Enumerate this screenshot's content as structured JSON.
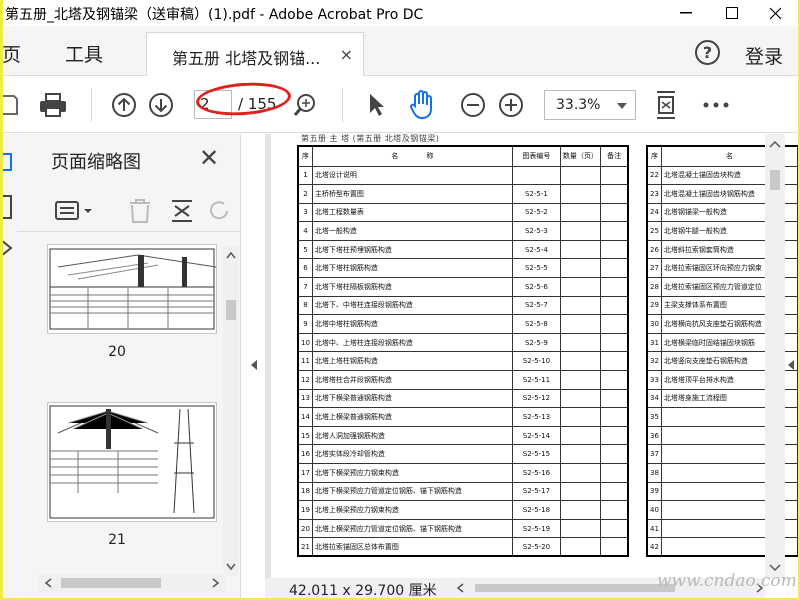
{
  "window": {
    "title": "第五册_北塔及钢锚梁（送审稿）(1).pdf - Adobe Acrobat Pro DC"
  },
  "tabs": {
    "home_label": "主页",
    "tools_label": "工具",
    "doc_tab_label": "第五册 北塔及钢锚...",
    "close_label": "×",
    "help_label": "?",
    "login_label": "登录"
  },
  "toolbar": {
    "current_page": "2",
    "page_total": "/ 155",
    "zoom": "33.3%"
  },
  "thumbnails": {
    "header": "页面缩略图",
    "items": [
      {
        "label": "20"
      },
      {
        "label": "21"
      }
    ]
  },
  "document": {
    "page_header": "第五册  主  塔 (第五册  北塔及钢锚梁)",
    "left_table": {
      "headers": [
        "序",
        "名　　　　称",
        "图表编号",
        "数量（页）",
        "备注"
      ],
      "rows": [
        [
          "1",
          "北塔设计说明",
          "",
          "",
          ""
        ],
        [
          "2",
          "主桥桥型布置图",
          "S2-5-1",
          "",
          ""
        ],
        [
          "3",
          "北塔工程数量表",
          "S2-5-2",
          "",
          ""
        ],
        [
          "4",
          "北塔一般构造",
          "S2-5-3",
          "",
          ""
        ],
        [
          "5",
          "北塔下塔柱预埋钢筋构造",
          "S2-5-4",
          "",
          ""
        ],
        [
          "6",
          "北塔下塔柱钢筋构造",
          "S2-5-5",
          "",
          ""
        ],
        [
          "7",
          "北塔下塔柱隔板钢筋构造",
          "S2-5-6",
          "",
          ""
        ],
        [
          "8",
          "北塔下、中塔柱连接段钢筋构造",
          "S2-5-7",
          "",
          ""
        ],
        [
          "9",
          "北塔中塔柱钢筋构造",
          "S2-5-8",
          "",
          ""
        ],
        [
          "10",
          "北塔中、上塔柱连接段钢筋构造",
          "S2-5-9",
          "",
          ""
        ],
        [
          "11",
          "北塔上塔柱钢筋构造",
          "S2-5-10",
          "",
          ""
        ],
        [
          "12",
          "北塔塔柱合并段钢筋构造",
          "S2-5-11",
          "",
          ""
        ],
        [
          "13",
          "北塔下横梁普通钢筋构造",
          "S2-5-12",
          "",
          ""
        ],
        [
          "14",
          "北塔上横梁普通钢筋构造",
          "S2-5-13",
          "",
          ""
        ],
        [
          "15",
          "北塔人洞加强钢筋构造",
          "S2-5-14",
          "",
          ""
        ],
        [
          "16",
          "北塔实体段冷却管构造",
          "S2-5-15",
          "",
          ""
        ],
        [
          "17",
          "北塔下横梁预应力钢束构造",
          "S2-5-16",
          "",
          ""
        ],
        [
          "18",
          "北塔下横梁预应力管道定位钢筋、锚下钢筋构造",
          "S2-5-17",
          "",
          ""
        ],
        [
          "19",
          "北塔上横梁预应力钢束构造",
          "S2-5-18",
          "",
          ""
        ],
        [
          "20",
          "北塔上横梁预应力管道定位钢筋、锚下钢筋构造",
          "S2-5-19",
          "",
          ""
        ],
        [
          "21",
          "北塔拉索锚固区总体布置图",
          "S2-5-20",
          "",
          ""
        ]
      ]
    },
    "right_table": {
      "headers": [
        "序",
        "名"
      ],
      "rows": [
        [
          "22",
          "北塔混凝土锚固齿块构造"
        ],
        [
          "23",
          "北塔混凝土锚固齿块钢筋构造"
        ],
        [
          "24",
          "北塔钢锚梁一般构造"
        ],
        [
          "25",
          "北塔钢牛腿一般构造"
        ],
        [
          "26",
          "北塔斜拉索钢套筒构造"
        ],
        [
          "27",
          "北塔拉索锚固区环向预应力钢束"
        ],
        [
          "28",
          "北塔拉索锚固区预应力管道定位"
        ],
        [
          "29",
          "主梁支撑体系布置图"
        ],
        [
          "30",
          "北塔横向抗风支座垫石钢筋构造"
        ],
        [
          "31",
          "北塔横梁临时固结锚固块钢筋"
        ],
        [
          "32",
          "北塔竖向支座垫石钢筋构造"
        ],
        [
          "33",
          "北塔塔顶平台排水构造"
        ],
        [
          "34",
          "北塔塔身施工流程图"
        ],
        [
          "35",
          ""
        ],
        [
          "36",
          ""
        ],
        [
          "37",
          ""
        ],
        [
          "38",
          ""
        ],
        [
          "39",
          ""
        ],
        [
          "40",
          ""
        ],
        [
          "41",
          ""
        ],
        [
          "42",
          ""
        ]
      ]
    }
  },
  "status": {
    "page_size": "42.011 x 29.700 厘米"
  },
  "watermark": "www.cndao.com",
  "colors": {
    "highlight_circle": "#e0201b",
    "frame_border": "#f2e94a"
  }
}
